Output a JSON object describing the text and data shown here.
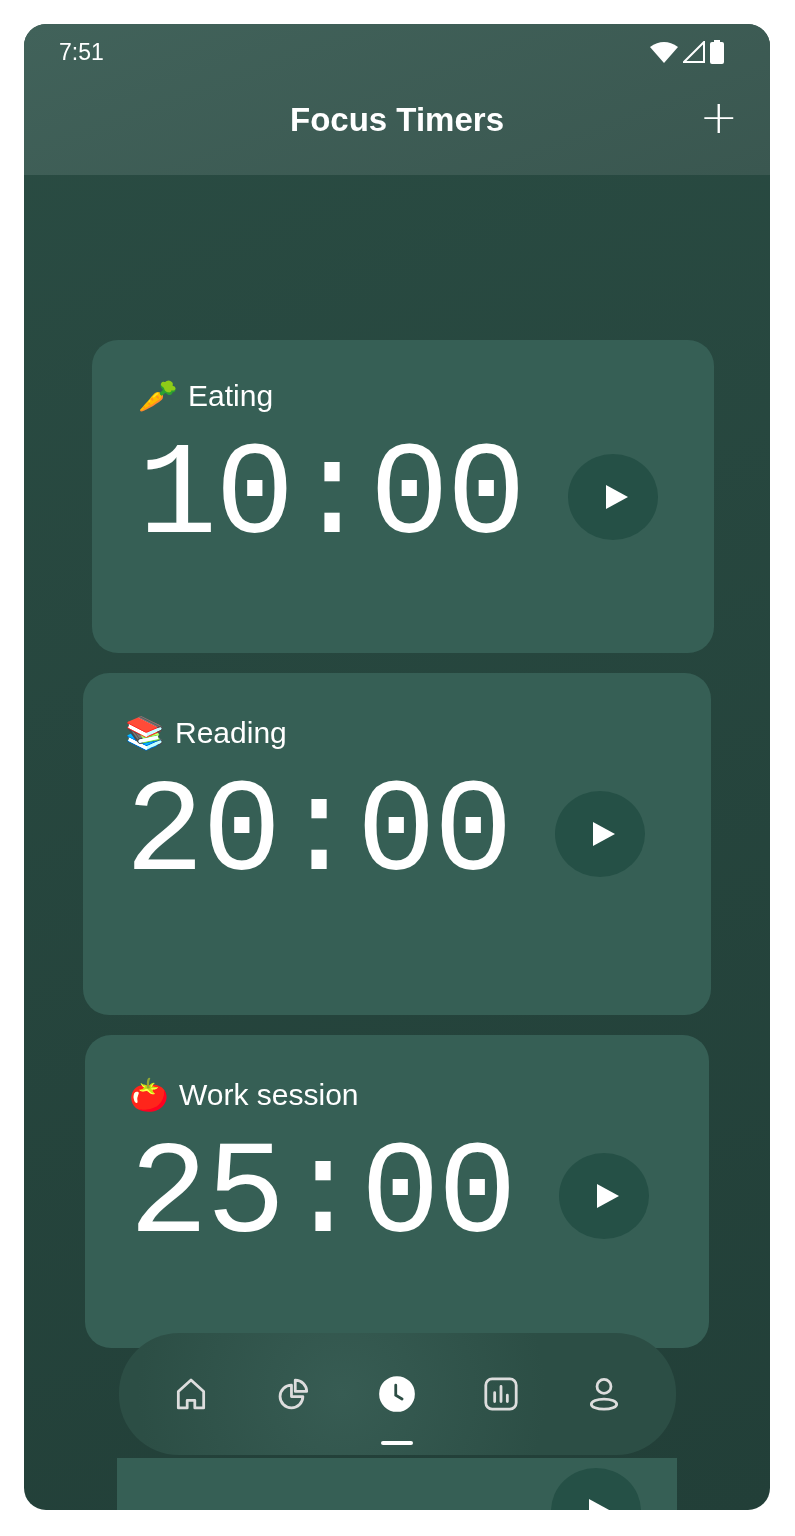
{
  "status_bar": {
    "time": "7:51"
  },
  "header": {
    "title": "Focus Timers",
    "add_icon": "+"
  },
  "cards": [
    {
      "kind": "timer",
      "emoji": "🥕",
      "title": "Eating",
      "time": "10:00"
    },
    {
      "kind": "timer",
      "emoji": "📚",
      "title": "Reading",
      "time": "20:00"
    },
    {
      "kind": "timer",
      "emoji": "🍅",
      "title": "Work session",
      "time": "25:00"
    },
    {
      "kind": "peek"
    }
  ],
  "nav": [
    {
      "selected": false
    },
    {
      "selected": false
    },
    {
      "selected": true
    },
    {
      "selected": false
    },
    {
      "selected": false
    }
  ]
}
